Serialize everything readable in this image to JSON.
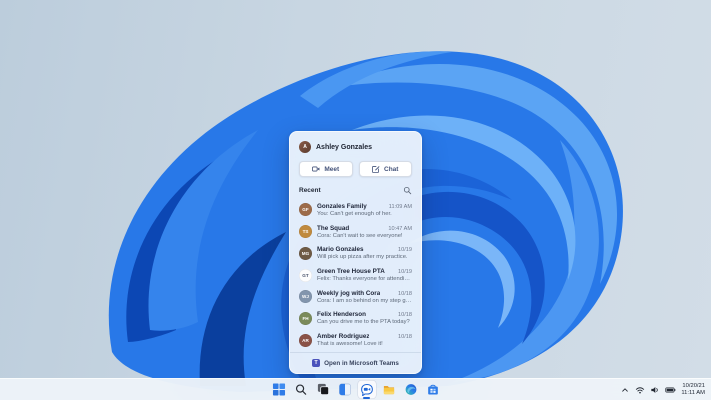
{
  "desktop": {
    "wallpaper": "windows-11-bloom"
  },
  "chat_flyout": {
    "user": {
      "name": "Ashley Gonzales",
      "initials": "A"
    },
    "actions": {
      "meet_label": "Meet",
      "chat_label": "Chat"
    },
    "recent": {
      "header": "Recent",
      "items": [
        {
          "name": "Gonzales Family",
          "preview": "You: Can't get enough of her.",
          "time": "11:09 AM",
          "initials": "GF",
          "avatar_bg": "#9c6b4a",
          "avatar_fg": "#ffffff"
        },
        {
          "name": "The Squad",
          "preview": "Cora: Can't wait to see everyone!",
          "time": "10:47 AM",
          "initials": "TS",
          "avatar_bg": "#c08a3e",
          "avatar_fg": "#ffffff"
        },
        {
          "name": "Mario Gonzales",
          "preview": "Will pick up pizza after my practice.",
          "time": "10/19",
          "initials": "MG",
          "avatar_bg": "#6e5a45",
          "avatar_fg": "#ffffff"
        },
        {
          "name": "Green Tree House PTA",
          "preview": "Felix: Thanks everyone for attending today.",
          "time": "10/19",
          "initials": "GT",
          "avatar_bg": "#fdfdfe",
          "avatar_fg": "#49536b"
        },
        {
          "name": "Weekly jog with Cora",
          "preview": "Cora: I am so behind on my step goals.",
          "time": "10/18",
          "initials": "WJ",
          "avatar_bg": "#8295ad",
          "avatar_fg": "#ffffff"
        },
        {
          "name": "Felix Henderson",
          "preview": "Can you drive me to the PTA today?",
          "time": "10/18",
          "initials": "FH",
          "avatar_bg": "#7a8a5a",
          "avatar_fg": "#ffffff"
        },
        {
          "name": "Amber Rodriguez",
          "preview": "That is awesome! Love it!",
          "time": "10/18",
          "initials": "AR",
          "avatar_bg": "#8a5247",
          "avatar_fg": "#ffffff"
        }
      ]
    },
    "footer": {
      "label": "Open in Microsoft Teams",
      "badge": "T"
    }
  },
  "taskbar": {
    "buttons": [
      "start",
      "search",
      "task-view",
      "widgets",
      "chat",
      "file-explorer",
      "edge",
      "store"
    ],
    "tray_icons": [
      "chevron-up",
      "wifi",
      "volume",
      "battery"
    ],
    "clock": {
      "date": "10/20/21",
      "time": "11:11 AM"
    }
  },
  "colors": {
    "accent": "#1f66d6",
    "bloom_main": "#2878e8",
    "bloom_dark": "#0c47b4",
    "bloom_light": "#6db1f8",
    "taskbar_bg": "#eef3f9"
  }
}
